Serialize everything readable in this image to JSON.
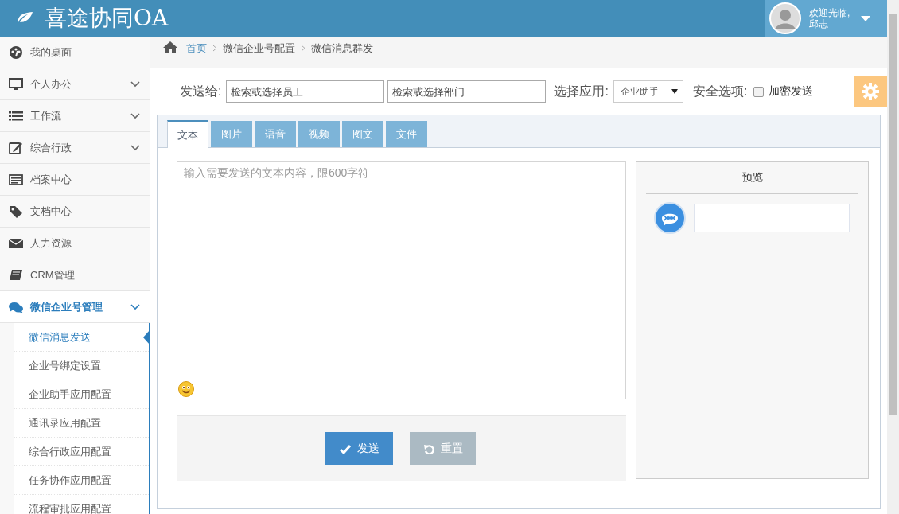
{
  "header": {
    "app_title": "喜途协同OA",
    "greeting": "欢迎光临,",
    "user_name": "邱志"
  },
  "sidebar": {
    "items": [
      {
        "label": "我的桌面",
        "kind": "link",
        "selected": false
      },
      {
        "label": "个人办公",
        "kind": "group",
        "selected": false
      },
      {
        "label": "工作流",
        "kind": "group",
        "selected": false
      },
      {
        "label": "综合行政",
        "kind": "group",
        "selected": false
      },
      {
        "label": "档案中心",
        "kind": "link",
        "selected": false
      },
      {
        "label": "文档中心",
        "kind": "link",
        "selected": false
      },
      {
        "label": "人力资源",
        "kind": "link",
        "selected": false
      },
      {
        "label": "CRM管理",
        "kind": "link",
        "selected": false
      },
      {
        "label": "微信企业号管理",
        "kind": "group",
        "selected": true,
        "expanded": true,
        "children": [
          {
            "label": "微信消息发送",
            "selected": true
          },
          {
            "label": "企业号绑定设置",
            "selected": false
          },
          {
            "label": "企业助手应用配置",
            "selected": false
          },
          {
            "label": "通讯录应用配置",
            "selected": false
          },
          {
            "label": "综合行政应用配置",
            "selected": false
          },
          {
            "label": "任务协作应用配置",
            "selected": false
          },
          {
            "label": "流程审批应用配置",
            "selected": false
          }
        ]
      }
    ]
  },
  "breadcrumb": [
    "首页",
    "微信企业号配置",
    "微信消息群发"
  ],
  "form": {
    "send_to_label": "发送给:",
    "employee_field": {
      "placeholder": "检索或选择员工"
    },
    "department_field": {
      "placeholder": "检索或选择部门"
    },
    "app_label": "选择应用:",
    "app_select": {
      "value": "企业助手"
    },
    "security_label": "安全选项:",
    "encrypt": {
      "label": "加密发送",
      "checked": false
    }
  },
  "tabs": [
    {
      "label": "文本",
      "selected": true
    },
    {
      "label": "图片",
      "selected": false
    },
    {
      "label": "语音",
      "selected": false
    },
    {
      "label": "视频",
      "selected": false
    },
    {
      "label": "图文",
      "selected": false
    },
    {
      "label": "文件",
      "selected": false
    }
  ],
  "message_box": {
    "placeholder": "输入需要发送的文本内容，限600字符"
  },
  "buttons": [
    {
      "label": "发送",
      "kind": "primary"
    },
    {
      "label": "重置",
      "kind": "reset"
    }
  ],
  "preview": {
    "title": "预览"
  }
}
